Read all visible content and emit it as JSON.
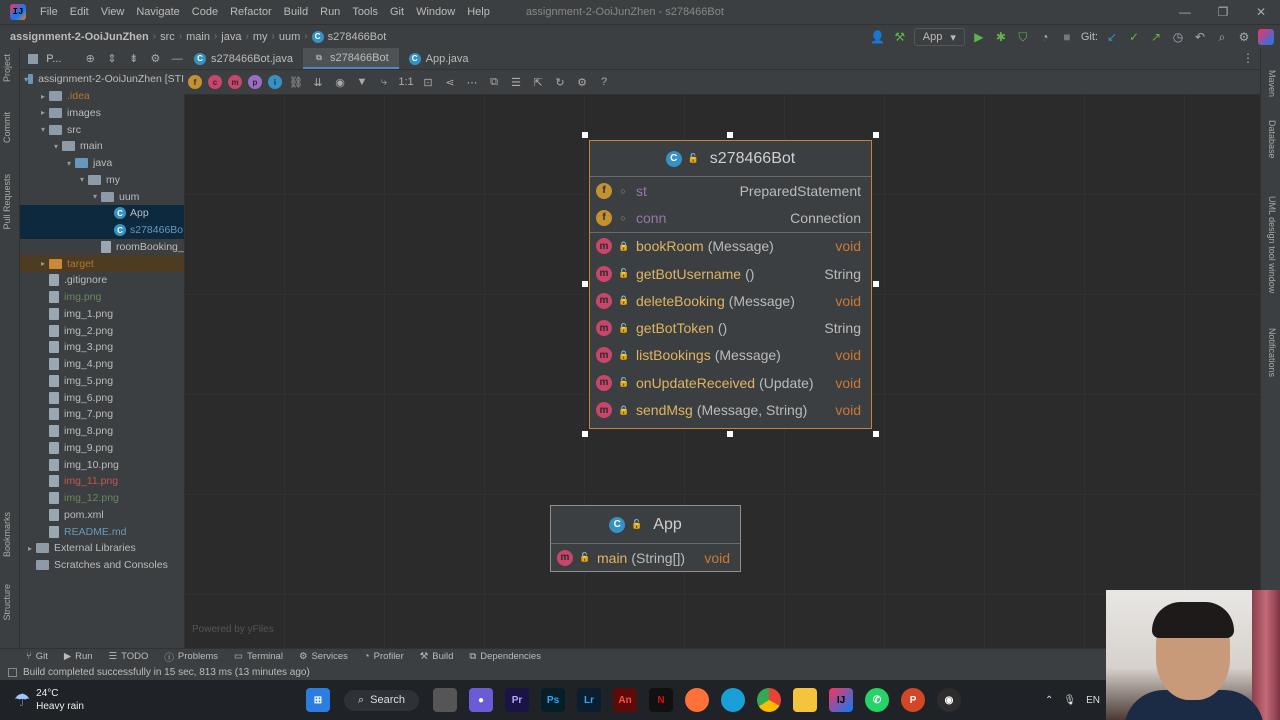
{
  "titlebar": {
    "menu": [
      "File",
      "Edit",
      "View",
      "Navigate",
      "Code",
      "Refactor",
      "Build",
      "Run",
      "Tools",
      "Git",
      "Window",
      "Help"
    ],
    "window_title": "assignment-2-OoiJunZhen - s278466Bot"
  },
  "navbar": {
    "breadcrumbs": [
      "assignment-2-OoiJunZhen",
      "src",
      "main",
      "java",
      "my",
      "uum",
      "s278466Bot"
    ],
    "run_config": "App",
    "git_label": "Git:"
  },
  "left_strip": {
    "labels": [
      "Project",
      "Commit",
      "Pull Requests",
      "Bookmarks",
      "Structure"
    ]
  },
  "right_strip": {
    "labels": [
      "Maven",
      "Database",
      "UML design tool window",
      "Notifications"
    ]
  },
  "project_panel": {
    "title": "P...",
    "tree": [
      {
        "label": "assignment-2-OoiJunZhen [STI",
        "kind": "folder-blue",
        "depth": 0,
        "arrow": "▾",
        "color": ""
      },
      {
        "label": ".idea",
        "kind": "folder",
        "depth": 1,
        "arrow": "▸",
        "color": "orange"
      },
      {
        "label": "images",
        "kind": "folder",
        "depth": 1,
        "arrow": "▸",
        "color": ""
      },
      {
        "label": "src",
        "kind": "folder",
        "depth": 1,
        "arrow": "▾",
        "color": ""
      },
      {
        "label": "main",
        "kind": "folder",
        "depth": 2,
        "arrow": "▾",
        "color": ""
      },
      {
        "label": "java",
        "kind": "folder-blue",
        "depth": 3,
        "arrow": "▾",
        "color": ""
      },
      {
        "label": "my",
        "kind": "folder",
        "depth": 4,
        "arrow": "▾",
        "color": ""
      },
      {
        "label": "uum",
        "kind": "folder",
        "depth": 5,
        "arrow": "▾",
        "color": ""
      },
      {
        "label": "App",
        "kind": "class",
        "depth": 6,
        "arrow": "",
        "color": "",
        "selected": true
      },
      {
        "label": "s278466Bo",
        "kind": "class",
        "depth": 6,
        "arrow": "",
        "color": "blue",
        "selected": true
      },
      {
        "label": "roomBooking_",
        "kind": "file",
        "depth": 5,
        "arrow": "",
        "color": ""
      },
      {
        "label": "target",
        "kind": "folder-orange",
        "depth": 1,
        "arrow": "▸",
        "color": "orange",
        "hilite": true
      },
      {
        "label": ".gitignore",
        "kind": "file",
        "depth": 1,
        "arrow": "",
        "color": ""
      },
      {
        "label": "img.png",
        "kind": "file",
        "depth": 1,
        "arrow": "",
        "color": "green"
      },
      {
        "label": "img_1.png",
        "kind": "file",
        "depth": 1,
        "arrow": "",
        "color": ""
      },
      {
        "label": "img_2.png",
        "kind": "file",
        "depth": 1,
        "arrow": "",
        "color": ""
      },
      {
        "label": "img_3.png",
        "kind": "file",
        "depth": 1,
        "arrow": "",
        "color": ""
      },
      {
        "label": "img_4.png",
        "kind": "file",
        "depth": 1,
        "arrow": "",
        "color": ""
      },
      {
        "label": "img_5.png",
        "kind": "file",
        "depth": 1,
        "arrow": "",
        "color": ""
      },
      {
        "label": "img_6.png",
        "kind": "file",
        "depth": 1,
        "arrow": "",
        "color": ""
      },
      {
        "label": "img_7.png",
        "kind": "file",
        "depth": 1,
        "arrow": "",
        "color": ""
      },
      {
        "label": "img_8.png",
        "kind": "file",
        "depth": 1,
        "arrow": "",
        "color": ""
      },
      {
        "label": "img_9.png",
        "kind": "file",
        "depth": 1,
        "arrow": "",
        "color": ""
      },
      {
        "label": "img_10.png",
        "kind": "file",
        "depth": 1,
        "arrow": "",
        "color": ""
      },
      {
        "label": "img_11.png",
        "kind": "file",
        "depth": 1,
        "arrow": "",
        "color": "red"
      },
      {
        "label": "img_12.png",
        "kind": "file",
        "depth": 1,
        "arrow": "",
        "color": "green"
      },
      {
        "label": "pom.xml",
        "kind": "file",
        "depth": 1,
        "arrow": "",
        "color": ""
      },
      {
        "label": "README.md",
        "kind": "file",
        "depth": 1,
        "arrow": "",
        "color": "blue"
      },
      {
        "label": "External Libraries",
        "kind": "folder",
        "depth": 0,
        "arrow": "▸",
        "color": ""
      },
      {
        "label": "Scratches and Consoles",
        "kind": "folder",
        "depth": 0,
        "arrow": "",
        "color": ""
      }
    ]
  },
  "tabs": [
    {
      "label": "s278466Bot.java",
      "active": false
    },
    {
      "label": "s278466Bot",
      "active": true
    },
    {
      "label": "App.java",
      "active": false
    }
  ],
  "diagram": {
    "powered_by": "Powered by yFiles",
    "classes": [
      {
        "name": "s278466Bot",
        "fields": [
          {
            "name": "st",
            "type": "PreparedStatement",
            "visibility": "pkg"
          },
          {
            "name": "conn",
            "type": "Connection",
            "visibility": "pkg"
          }
        ],
        "methods": [
          {
            "name": "bookRoom",
            "params": "(Message)",
            "type": "void",
            "visibility": "private"
          },
          {
            "name": "getBotUsername",
            "params": "()",
            "type": "String",
            "visibility": "public"
          },
          {
            "name": "deleteBooking",
            "params": "(Message)",
            "type": "void",
            "visibility": "private"
          },
          {
            "name": "getBotToken",
            "params": "()",
            "type": "String",
            "visibility": "public"
          },
          {
            "name": "listBookings",
            "params": "(Message)",
            "type": "void",
            "visibility": "private"
          },
          {
            "name": "onUpdateReceived",
            "params": "(Update)",
            "type": "void",
            "visibility": "public"
          },
          {
            "name": "sendMsg",
            "params": "(Message, String)",
            "type": "void",
            "visibility": "private"
          }
        ]
      },
      {
        "name": "App",
        "fields": [],
        "methods": [
          {
            "name": "main",
            "params": "(String[])",
            "type": "void",
            "visibility": "public"
          }
        ]
      }
    ]
  },
  "bottom_tools": [
    "Git",
    "Run",
    "TODO",
    "Problems",
    "Terminal",
    "Services",
    "Profiler",
    "Build",
    "Dependencies"
  ],
  "status": {
    "message": "Build completed successfully in 15 sec, 813 ms (13 minutes ago)"
  },
  "taskbar": {
    "weather_temp": "24°C",
    "weather_desc": "Heavy rain",
    "search_label": "Search",
    "tray_lang": "EN"
  }
}
